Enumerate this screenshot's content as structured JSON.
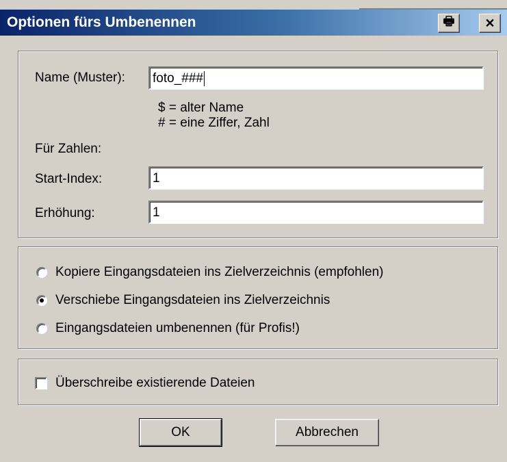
{
  "window": {
    "title": "Optionen fürs Umbenennen",
    "print_icon": "🖶",
    "close_icon": "✕"
  },
  "name_group": {
    "name_label": "Name (Muster):",
    "name_value": "foto_###",
    "hint1": "$ = alter Name",
    "hint2": "# = eine Ziffer, Zahl",
    "numbers_label": "Für Zahlen:",
    "start_label": "Start-Index:",
    "start_value": "1",
    "step_label": "Erhöhung:",
    "step_value": "1"
  },
  "mode_group": {
    "options": [
      {
        "label": "Kopiere Eingangsdateien ins Zielverzeichnis (empfohlen)",
        "checked": false
      },
      {
        "label": "Verschiebe Eingangsdateien ins Zielverzeichnis",
        "checked": true
      },
      {
        "label": "Eingangsdateien umbenennen (für Profis!)",
        "checked": false
      }
    ]
  },
  "overwrite": {
    "label": "Überschreibe existierende Dateien",
    "checked": false
  },
  "buttons": {
    "ok": "OK",
    "cancel": "Abbrechen"
  }
}
